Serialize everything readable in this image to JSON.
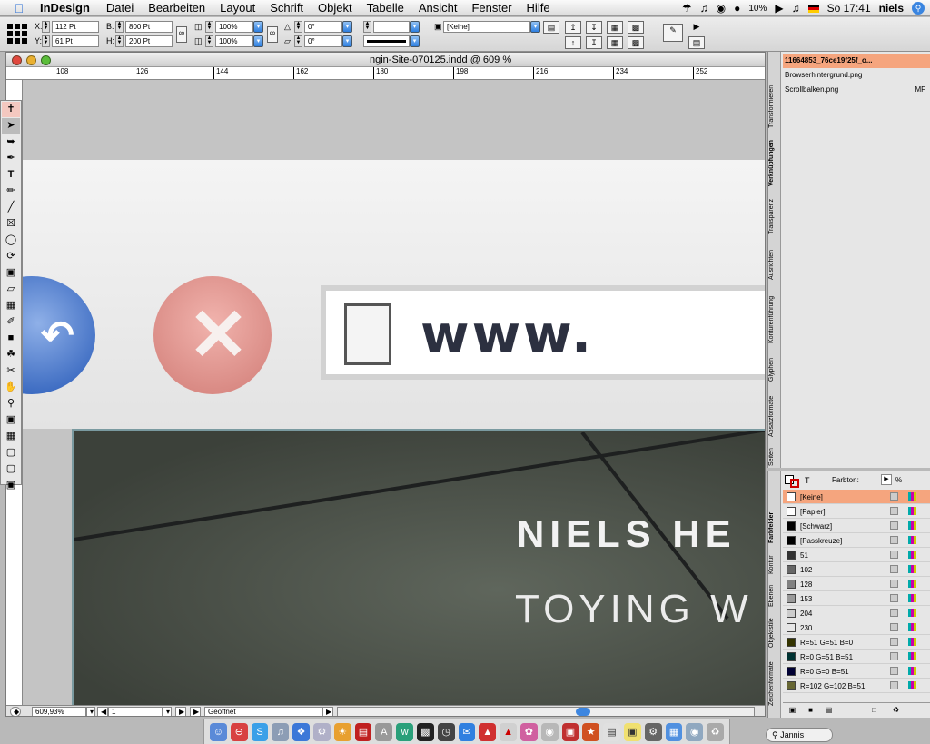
{
  "menubar": {
    "app_name": "InDesign",
    "items": [
      "Datei",
      "Bearbeiten",
      "Layout",
      "Schrift",
      "Objekt",
      "Tabelle",
      "Ansicht",
      "Fenster",
      "Hilfe"
    ],
    "battery": "10%",
    "clock": "So 17:41",
    "user": "niels"
  },
  "control_panel": {
    "x_label": "X:",
    "x_value": "112 Pt",
    "y_label": "Y:",
    "y_value": "61 Pt",
    "w_label": "B:",
    "w_value": "800 Pt",
    "h_label": "H:",
    "h_value": "200 Pt",
    "scale_x": "100%",
    "scale_y": "100%",
    "rotate": "0°",
    "shear": "0°",
    "style_value": "[Keine]"
  },
  "document": {
    "title": "ngin-Site-070125.indd @ 609 %",
    "ruler_marks": [
      "108",
      "126",
      "144",
      "162",
      "180",
      "198",
      "216",
      "234",
      "252"
    ],
    "url_text": "www.",
    "headline": "NIELS HE",
    "subline": "TOYING W",
    "zoom": "609,93%",
    "page": "1",
    "status": "Geöffnet"
  },
  "links_panel": {
    "tabs": [
      "Transformieren",
      "Verknüpfungen",
      "Transparenz",
      "Ausrichten",
      "Konturenführung",
      "Glyphen",
      "Absatzformate",
      "Seiten"
    ],
    "items": [
      {
        "name": "11664853_76ce19f25f_o...",
        "status": "",
        "selected": true
      },
      {
        "name": "Browserhintergrund.png",
        "status": "",
        "selected": false
      },
      {
        "name": "Scrollbalken.png",
        "status": "MF",
        "selected": false
      }
    ]
  },
  "swatches_panel": {
    "tint_label": "Farbton:",
    "tint_unit": "%",
    "tabs": [
      "Farbfelder",
      "Kontur",
      "Ebenen",
      "Objektstile",
      "Zeichenformate"
    ],
    "items": [
      {
        "name": "[Keine]",
        "color": "#ffffff",
        "selected": true
      },
      {
        "name": "[Papier]",
        "color": "#ffffff",
        "selected": false
      },
      {
        "name": "[Schwarz]",
        "color": "#000000",
        "selected": false
      },
      {
        "name": "[Passkreuze]",
        "color": "#000000",
        "selected": false
      },
      {
        "name": "51",
        "color": "#333333",
        "selected": false
      },
      {
        "name": "102",
        "color": "#666666",
        "selected": false
      },
      {
        "name": "128",
        "color": "#808080",
        "selected": false
      },
      {
        "name": "153",
        "color": "#999999",
        "selected": false
      },
      {
        "name": "204",
        "color": "#cccccc",
        "selected": false
      },
      {
        "name": "230",
        "color": "#e6e6e6",
        "selected": false
      },
      {
        "name": "R=51 G=51 B=0",
        "color": "#333300",
        "selected": false
      },
      {
        "name": "R=0 G=51 B=51",
        "color": "#003333",
        "selected": false
      },
      {
        "name": "R=0 G=0 B=51",
        "color": "#000033",
        "selected": false
      },
      {
        "name": "R=102 G=102 B=51",
        "color": "#666633",
        "selected": false
      }
    ]
  },
  "dock": {
    "finder_user": "Jannis"
  }
}
